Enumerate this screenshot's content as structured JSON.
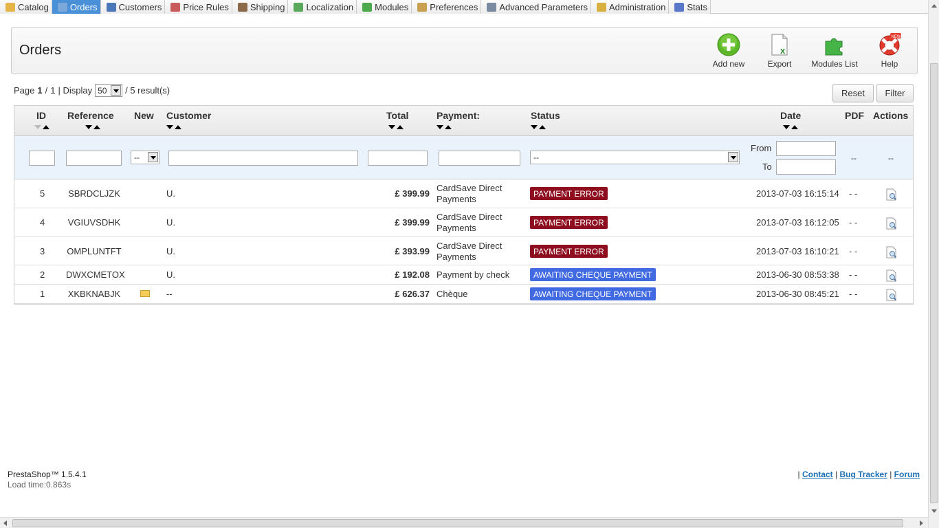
{
  "menu": {
    "tabs": [
      {
        "label": "Catalog",
        "icon": "folder-icon",
        "color": "#e6b54a"
      },
      {
        "label": "Orders",
        "icon": "cart-icon",
        "color": "#7aa8d8"
      },
      {
        "label": "Customers",
        "icon": "user-icon",
        "color": "#4a78b8"
      },
      {
        "label": "Price Rules",
        "icon": "price-tag-icon",
        "color": "#c85a5a"
      },
      {
        "label": "Shipping",
        "icon": "truck-icon",
        "color": "#8b6b4a"
      },
      {
        "label": "Localization",
        "icon": "globe-icon",
        "color": "#5aa85a"
      },
      {
        "label": "Modules",
        "icon": "puzzle-icon",
        "color": "#4caa4c"
      },
      {
        "label": "Preferences",
        "icon": "wrench-icon",
        "color": "#c8a050"
      },
      {
        "label": "Advanced Parameters",
        "icon": "gear-icon",
        "color": "#7a8aa0"
      },
      {
        "label": "Administration",
        "icon": "key-icon",
        "color": "#d8b040"
      },
      {
        "label": "Stats",
        "icon": "chart-icon",
        "color": "#5a78c8"
      }
    ],
    "active": "Orders"
  },
  "toolbar": {
    "title": "Orders",
    "add_new": "Add new",
    "export": "Export",
    "modules_list": "Modules List",
    "help": "Help",
    "help_badge": "NEW"
  },
  "pagination": {
    "page_label": "Page",
    "current": "1",
    "sep": "/",
    "total": "1",
    "display_label": "| Display",
    "per_page": "50",
    "results": "/ 5 result(s)"
  },
  "buttons": {
    "reset": "Reset",
    "filter": "Filter"
  },
  "columns": {
    "id": "ID",
    "reference": "Reference",
    "new": "New",
    "customer": "Customer",
    "total": "Total",
    "payment": "Payment:",
    "status": "Status",
    "date": "Date",
    "pdf": "PDF",
    "actions": "Actions"
  },
  "filters": {
    "new_value": "--",
    "status_value": "--",
    "from_label": "From",
    "to_label": "To",
    "pdf_value": "--",
    "actions_value": "--"
  },
  "orders": [
    {
      "id": "5",
      "reference": "SBRDCLJZK",
      "new": false,
      "customer": "U.",
      "total": "£ 399.99",
      "payment_line1": "CardSave Direct",
      "payment_line2": "Payments",
      "status": "PAYMENT ERROR",
      "status_color": "#8e0e1f",
      "date": "2013-07-03 16:15:14",
      "pdf": "-  -"
    },
    {
      "id": "4",
      "reference": "VGIUVSDHK",
      "new": false,
      "customer": "U.",
      "total": "£ 399.99",
      "payment_line1": "CardSave Direct",
      "payment_line2": "Payments",
      "status": "PAYMENT ERROR",
      "status_color": "#8e0e1f",
      "date": "2013-07-03 16:12:05",
      "pdf": "-  -"
    },
    {
      "id": "3",
      "reference": "OMPLUNTFT",
      "new": false,
      "customer": "U.",
      "total": "£ 393.99",
      "payment_line1": "CardSave Direct",
      "payment_line2": "Payments",
      "status": "PAYMENT ERROR",
      "status_color": "#8e0e1f",
      "date": "2013-07-03 16:10:21",
      "pdf": "-  -"
    },
    {
      "id": "2",
      "reference": "DWXCMETOX",
      "new": false,
      "customer": "U.",
      "total": "£ 192.08",
      "payment_line1": "Payment by check",
      "payment_line2": "",
      "status": "AWAITING CHEQUE PAYMENT",
      "status_color": "#4169e1",
      "date": "2013-06-30 08:53:38",
      "pdf": "-  -"
    },
    {
      "id": "1",
      "reference": "XKBKNABJK",
      "new": true,
      "customer": "--",
      "total": "£ 626.37",
      "payment_line1": "Chèque",
      "payment_line2": "",
      "status": "AWAITING CHEQUE PAYMENT",
      "status_color": "#4169e1",
      "date": "2013-06-30 08:45:21",
      "pdf": "-  -"
    }
  ],
  "footer": {
    "version": "PrestaShop™ 1.5.4.1",
    "load_time": "Load time:0.863s",
    "contact": "Contact",
    "bug_tracker": "Bug Tracker",
    "forum": "Forum",
    "sep": "|"
  }
}
